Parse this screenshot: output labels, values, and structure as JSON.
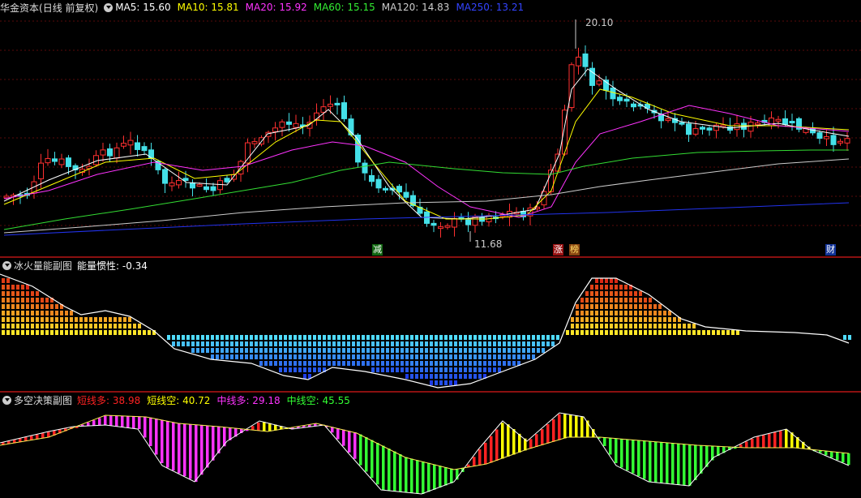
{
  "main": {
    "stock_name": "华金资本",
    "period": "(日线 前复权)",
    "ma": [
      {
        "label": "MA5: 15.60",
        "color": "#ffffff"
      },
      {
        "label": "MA10: 15.81",
        "color": "#ffff00"
      },
      {
        "label": "MA20: 15.92",
        "color": "#ff33ff"
      },
      {
        "label": "MA60: 15.15",
        "color": "#33ee33"
      },
      {
        "label": "MA120: 14.83",
        "color": "#cccccc"
      },
      {
        "label": "MA250: 13.21",
        "color": "#3344ff"
      }
    ],
    "high_label": "20.10",
    "low_label": "11.68",
    "tags": [
      {
        "text": "减",
        "bg": "#116611",
        "color": "#ffffff"
      },
      {
        "text": "涨",
        "bg": "#991111",
        "color": "#ffffff"
      },
      {
        "text": "榜",
        "bg": "#884411",
        "color": "#ffdd66"
      },
      {
        "text": "财",
        "bg": "#113399",
        "color": "#ffffff"
      }
    ]
  },
  "energy": {
    "title": "冰火量能副图",
    "inertia_label": "能量惯性: -0.34"
  },
  "decision": {
    "title": "多空决策副图",
    "items": [
      {
        "label": "短线多: 38.98",
        "color": "#ff2222"
      },
      {
        "label": "短线空: 40.72",
        "color": "#ffff00"
      },
      {
        "label": "中线多: 29.18",
        "color": "#ff33ff"
      },
      {
        "label": "中线空: 45.55",
        "color": "#33ff33"
      }
    ]
  }
}
